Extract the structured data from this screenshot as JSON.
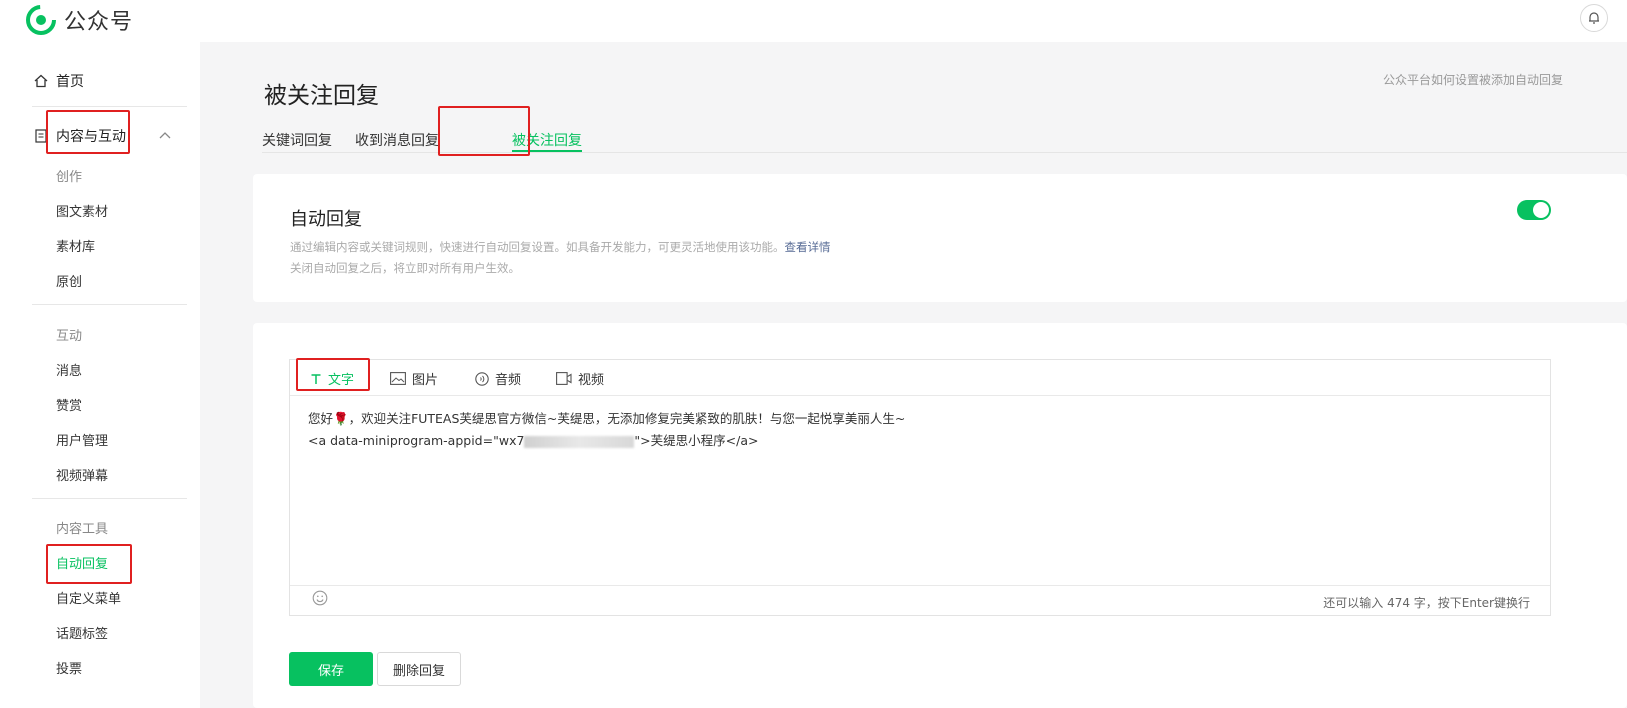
{
  "brand": {
    "name": "公众号",
    "color": "#07c160"
  },
  "header": {
    "bell_icon": "bell-icon"
  },
  "sidebar": {
    "home": "首页",
    "content_interaction": "内容与互动",
    "group_create": "创作",
    "create_items": [
      "图文素材",
      "素材库",
      "原创"
    ],
    "group_interaction": "互动",
    "interaction_items": [
      "消息",
      "赞赏",
      "用户管理",
      "视频弹幕"
    ],
    "group_tools": "内容工具",
    "tool_items": [
      "自动回复",
      "自定义菜单",
      "话题标签",
      "投票"
    ]
  },
  "page": {
    "title": "被关注回复",
    "help_link": "公众平台如何设置被添加自动回复",
    "tabs": [
      "关键词回复",
      "收到消息回复",
      "被关注回复"
    ],
    "active_tab": "被关注回复"
  },
  "auto_reply": {
    "title": "自动回复",
    "desc": "通过编辑内容或关键词规则，快速进行自动回复设置。如具备开发能力，可更灵活地使用该功能。",
    "detail_link": "查看详情",
    "desc2": "关闭自动回复之后，将立即对所有用户生效。",
    "enabled": true
  },
  "editor": {
    "tabs": [
      "文字",
      "图片",
      "音频",
      "视频"
    ],
    "active_tab": "文字",
    "line1": "您好🌹，欢迎关注FUTEAS芙缇思官方微信~芙缇思，无添加修复完美紧致的肌肤！与您一起悦享美丽人生~",
    "line2_prefix": "<a data-miniprogram-appid=\"wx7",
    "line2_suffix": "\">芙缇思小程序</a>",
    "char_count": "还可以输入 474 字，按下Enter键换行"
  },
  "actions": {
    "save": "保存",
    "delete": "删除回复"
  }
}
